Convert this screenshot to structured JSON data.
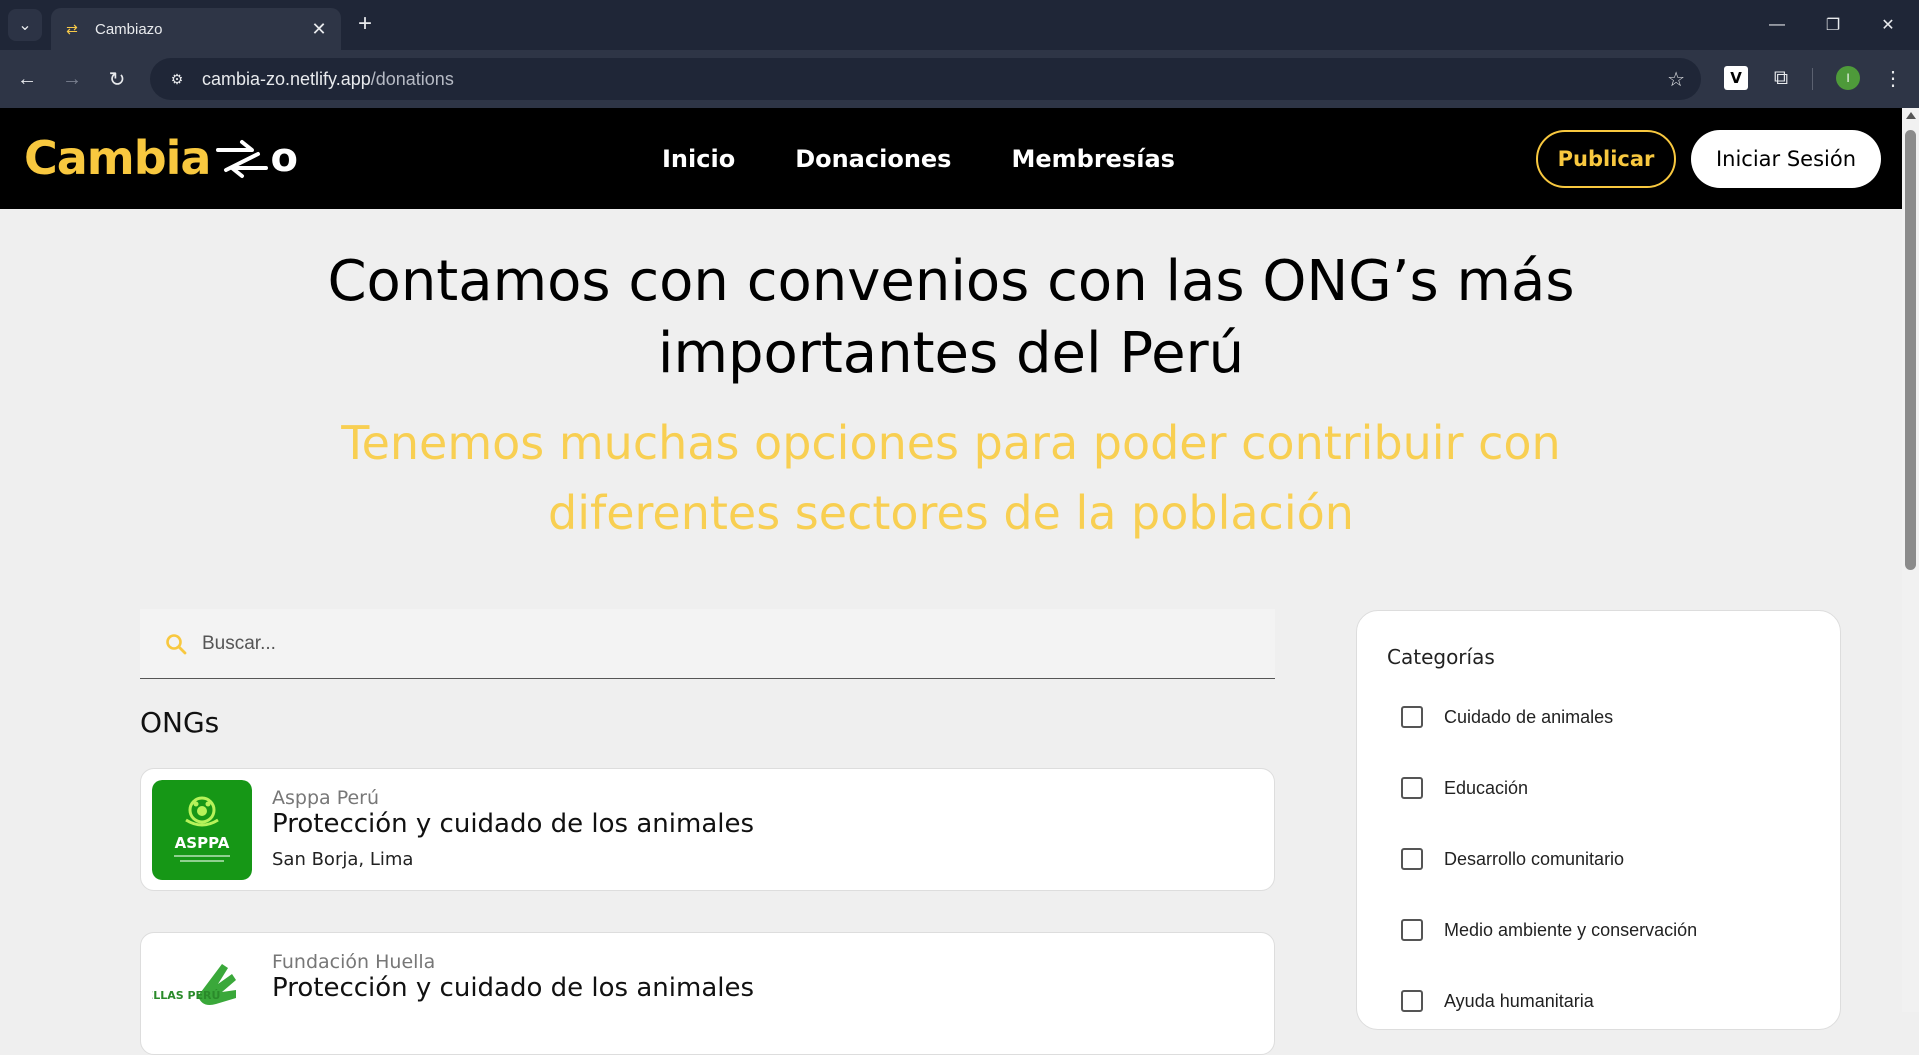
{
  "browser": {
    "tab_title": "Cambiazo",
    "url_host": "cambia-zo.netlify.app",
    "url_path": "/donations",
    "profile_initial": "I",
    "extension_letter": "V"
  },
  "site": {
    "logo_text": "Cambia",
    "logo_tail": "o",
    "nav": [
      "Inicio",
      "Donaciones",
      "Membresías"
    ],
    "publish_label": "Publicar",
    "login_label": "Iniciar Sesión"
  },
  "hero": {
    "title_line1": "Contamos con convenios con las ONG’s más",
    "title_line2": "importantes del Perú",
    "subtitle_line1": "Tenemos muchas opciones para poder contribuir con",
    "subtitle_line2": "diferentes sectores de la población"
  },
  "search": {
    "placeholder": "Buscar..."
  },
  "ongs_section_title": "ONGs",
  "ongs": [
    {
      "logo_text": "ASPPA",
      "name": "Asppa Perú",
      "category": "Protección y cuidado de los animales",
      "location": "San Borja, Lima"
    },
    {
      "logo_text": "HUELLAS PERÚ",
      "name": "Fundación Huella",
      "category": "Protección y cuidado de los animales",
      "location": ""
    }
  ],
  "categories": {
    "title": "Categorías",
    "items": [
      "Cuidado de animales",
      "Educación",
      "Desarrollo comunitario",
      "Medio ambiente y conservación",
      "Ayuda humanitaria"
    ]
  },
  "colors": {
    "brand_yellow": "#f8c83f",
    "header_bg": "#000000",
    "page_bg": "#efefef"
  }
}
